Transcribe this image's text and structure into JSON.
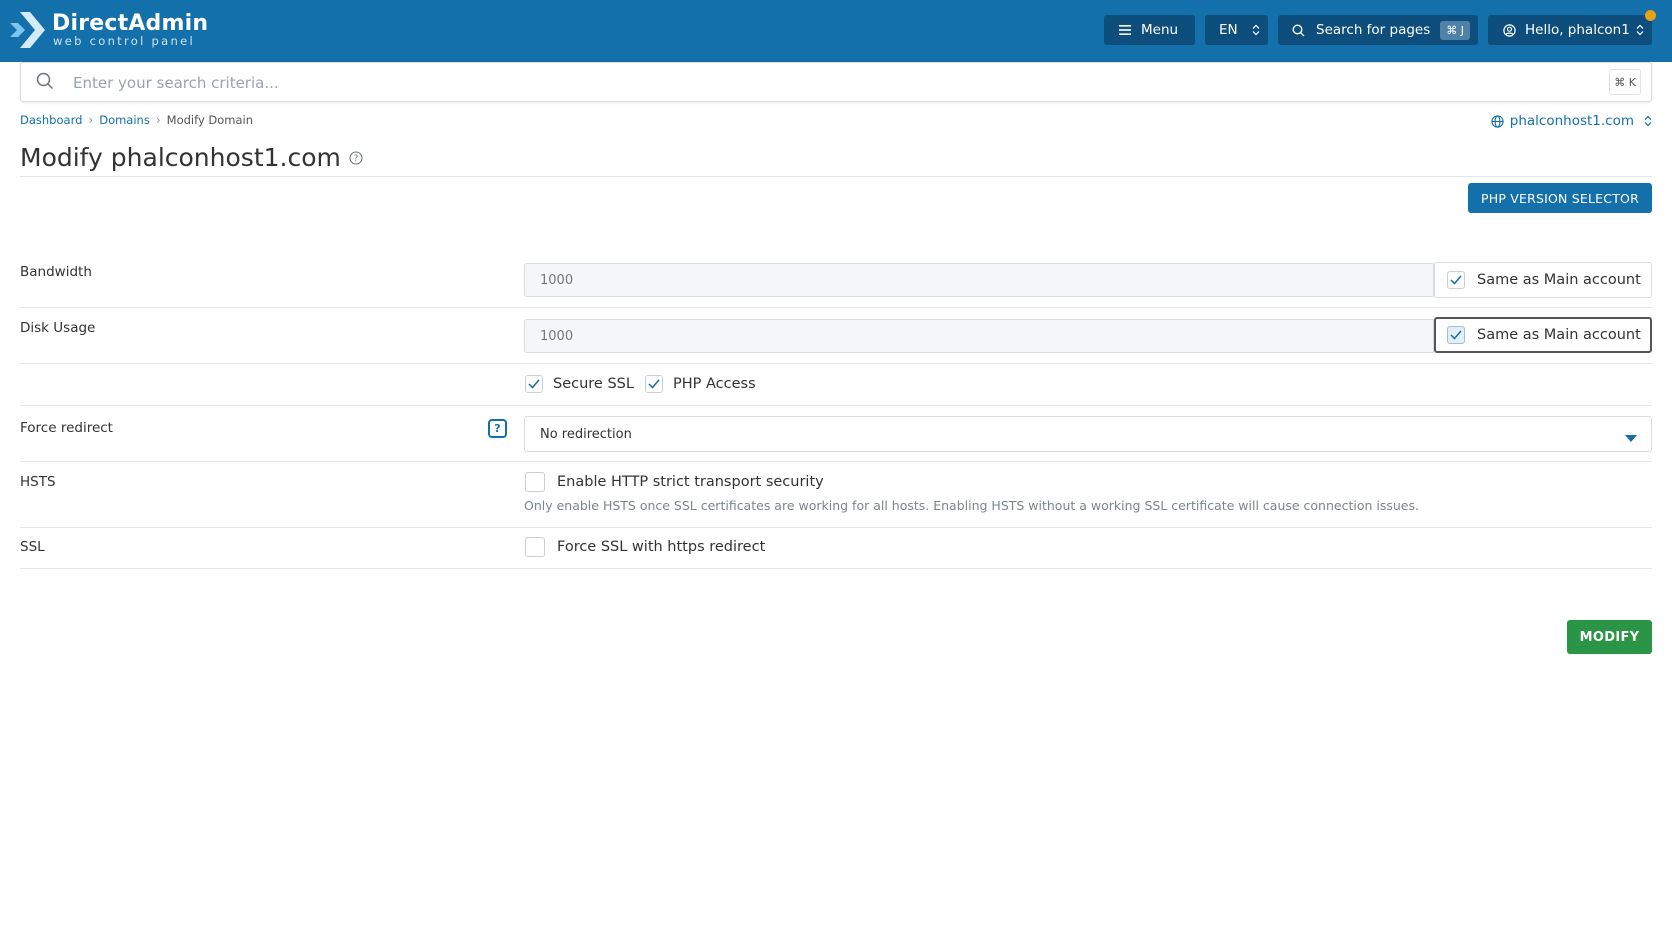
{
  "header": {
    "logo_name": "DirectAdmin",
    "logo_sub": "web control panel",
    "menu_label": "Menu",
    "lang_label": "EN",
    "search_pages_label": "Search for pages",
    "search_pages_shortcut": "⌘ J",
    "user_label": "Hello, phalcon1",
    "brand_color": "#1470ab"
  },
  "search": {
    "placeholder": "Enter your search criteria...",
    "shortcut": "⌘ K"
  },
  "breadcrumb": {
    "items": [
      "Dashboard",
      "Domains"
    ],
    "current": "Modify Domain"
  },
  "domain_selector": "phalconhost1.com",
  "page": {
    "title": "Modify phalconhost1.com",
    "php_version_button": "PHP VERSION SELECTOR"
  },
  "form": {
    "bandwidth": {
      "label": "Bandwidth",
      "value": "1000",
      "same_label": "Same as Main account",
      "same_checked": true
    },
    "disk_usage": {
      "label": "Disk Usage",
      "value": "1000",
      "same_label": "Same as Main account",
      "same_checked": true
    },
    "options": [
      {
        "label": "Secure SSL",
        "checked": true
      },
      {
        "label": "PHP Access",
        "checked": true
      }
    ],
    "force_redirect": {
      "label": "Force redirect",
      "help": "?",
      "value": "No redirection"
    },
    "hsts": {
      "label": "HSTS",
      "option_label": "Enable HTTP strict transport security",
      "checked": false,
      "hint": "Only enable HSTS once SSL certificates are working for all hosts. Enabling HSTS without a working SSL certificate will cause connection issues."
    },
    "ssl": {
      "label": "SSL",
      "option_label": "Force SSL with https redirect",
      "checked": false
    },
    "submit_label": "MODIFY"
  }
}
